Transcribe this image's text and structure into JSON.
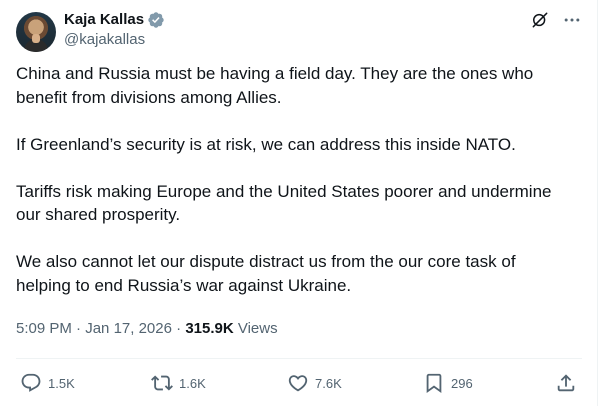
{
  "author": {
    "display_name": "Kaja Kallas",
    "handle": "@kajakallas",
    "verified": true
  },
  "header_icons": [
    "grok-icon",
    "more-icon"
  ],
  "tweet": {
    "paragraphs": [
      "China and Russia must be having a field day. They are the ones who\nbenefit from divisions among Allies.",
      "If Greenland’s security is at risk, we can address this inside NATO.",
      "Tariffs risk making Europe and the United States poorer and undermine\nour shared prosperity.",
      "We also cannot let our dispute distract us from the our core task of\nhelping to end Russia’s war against Ukraine."
    ]
  },
  "meta": {
    "time": "5:09 PM",
    "date": "Jan 17, 2026",
    "views_count": "315.9K",
    "views_label": "Views",
    "separator": "·"
  },
  "actions": {
    "replies": "1.5K",
    "reposts": "1.6K",
    "likes": "7.6K",
    "bookmarks": "296"
  },
  "colors": {
    "text_primary": "#0f1419",
    "text_secondary": "#536471",
    "verified": "#829aab",
    "divider": "#eff3f4"
  }
}
